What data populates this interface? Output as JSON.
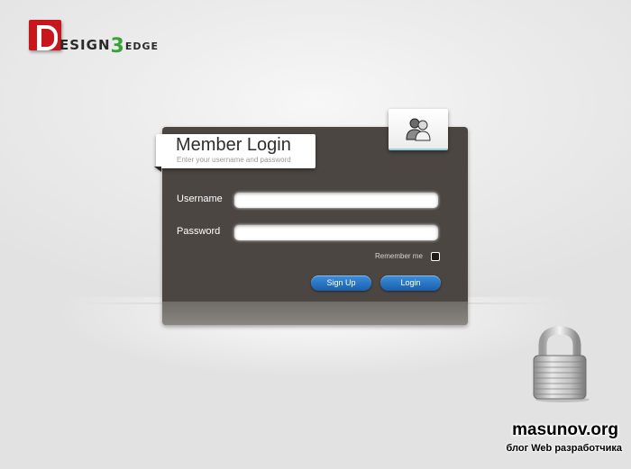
{
  "logo": {
    "letter_d": "D",
    "text_main": "ESIGN",
    "text_three": "3",
    "text_edge": "EDGE"
  },
  "login": {
    "title": "Member Login",
    "subtitle": "Enter your username and password",
    "username_label": "Username",
    "username_value": "",
    "password_label": "Password",
    "password_value": "",
    "remember_label": "Remember me",
    "remember_checked": false,
    "signup_label": "Sign Up",
    "login_label": "Login",
    "icon": "users-icon"
  },
  "watermark": {
    "title": "masunov.org",
    "subtitle": "блог Web разработчика"
  },
  "colors": {
    "panel": "#4c4642",
    "button": "#1f6fc4",
    "logo_red": "#c8161d",
    "logo_green": "#3aa23a"
  }
}
